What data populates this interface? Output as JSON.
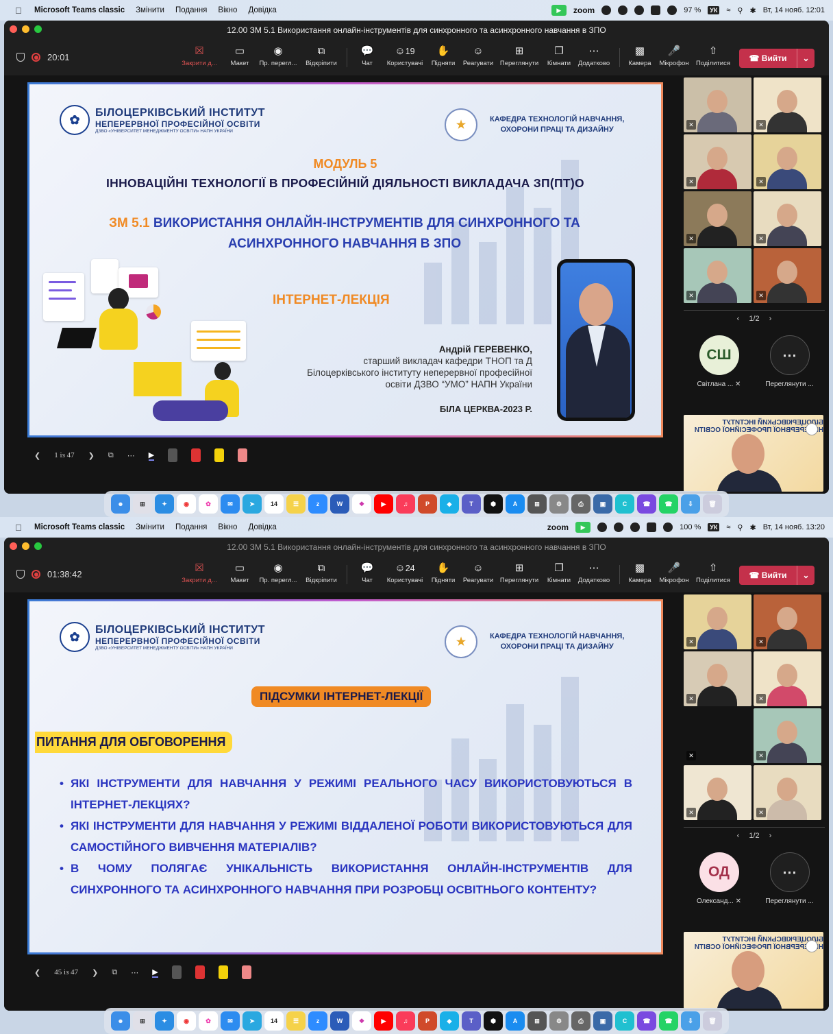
{
  "menubar": {
    "app": "Microsoft Teams classic",
    "menus": [
      "Змінити",
      "Подання",
      "Вікно",
      "Довідка"
    ],
    "zoom_label": "zoom",
    "keyboard": "УК"
  },
  "toolbar_labels": {
    "close": "Закрити д...",
    "layout": "Макет",
    "preview": "Пр. перегл...",
    "popout": "Відкріпити",
    "chat": "Чат",
    "people": "Користувачі",
    "raise": "Підняти",
    "react": "Реагувати",
    "view": "Переглянути",
    "rooms": "Кімнати",
    "more": "Додатково",
    "camera": "Камера",
    "mic": "Мікрофон",
    "share": "Поділитися",
    "leave": "Вийти"
  },
  "window_title": "12.00 ЗМ 5.1 Використання онлайн-інструментів для синхронного та асинхронного навчання в ЗПО",
  "slide_header": {
    "institute_l1": "БІЛОЦЕРКІВСЬКИЙ ІНСТИТУТ",
    "institute_l2": "НЕПЕРЕРВНОЇ ПРОФЕСІЙНОЇ ОСВІТИ",
    "institute_l3": "ДЗВО «УНІВЕРСИТЕТ МЕНЕДЖМЕНТУ ОСВІТИ» НАПН УКРАЇНИ",
    "dept_l1": "КАФЕДРА ТЕХНОЛОГІЙ НАВЧАННЯ,",
    "dept_l2": "ОХОРОНИ ПРАЦІ ТА ДИЗАЙНУ"
  },
  "shot1": {
    "battery": "97 %",
    "datetime": "Вт, 14 нояб.  12:01",
    "timer": "20:01",
    "people_count": "19",
    "slide": {
      "module": "МОДУЛЬ 5",
      "title": "ІННОВАЦІЙНІ ТЕХНОЛОГІЇ В ПРОФЕСІЙНІЙ ДІЯЛЬНОСТІ ВИКЛАДАЧА ЗП(ПТ)О",
      "sub_prefix": "ЗМ 5.1",
      "sub_text": "ВИКОРИСТАННЯ ОНЛАЙН-ІНСТРУМЕНТІВ ДЛЯ СИНХРОННОГО ТА АСИНХРОННОГО НАВЧАННЯ В ЗПО",
      "lecture": "ІНТЕРНЕТ-ЛЕКЦІЯ",
      "author_name": "Андрій ГЕРЕВЕНКО,",
      "author_l1": "старший викладач кафедри ТНОП та Д",
      "author_l2": "Білоцерківського інституту неперервної професійної",
      "author_l3": "освіти ДЗВО “УМО” НАПН України",
      "city": "БІЛА ЦЕРКВА-2023 Р."
    },
    "page": "1 із 47",
    "pager": "1/2",
    "avatar_initials": "СШ",
    "avatar_name": "Світлана ...",
    "more_label": "Переглянути ..."
  },
  "shot2": {
    "battery": "100 %",
    "datetime": "Вт, 14 нояб.  13:20",
    "timer": "01:38:42",
    "people_count": "24",
    "slide": {
      "summary": "ПІДСУМКИ ІНТЕРНЕТ-ЛЕКЦІЇ",
      "questions": "ПИТАННЯ ДЛЯ ОБГОВОРЕННЯ",
      "q1": "ЯКІ ІНСТРУМЕНТИ ДЛЯ НАВЧАННЯ У РЕЖИМІ РЕАЛЬНОГО ЧАСУ ВИКОРИСТОВУЮТЬСЯ В ІНТЕРНЕТ-ЛЕКЦІЯХ?",
      "q2": "ЯКІ ІНСТРУМЕНТИ ДЛЯ НАВЧАННЯ У РЕЖИМІ ВІДДАЛЕНОЇ РОБОТИ ВИКОРИСТОВУЮТЬСЯ ДЛЯ САМОСТІЙНОГО ВИВЧЕННЯ МАТЕРІАЛІВ?",
      "q3": "В ЧОМУ ПОЛЯГАЄ УНІКАЛЬНІСТЬ ВИКОРИСТАННЯ ОНЛАЙН-ІНСТРУМЕНТІВ ДЛЯ СИНХРОННОГО ТА АСИНХРОННОГО НАВЧАННЯ ПРИ РОЗРОБЦІ ОСВІТНЬОГО КОНТЕНТУ?"
    },
    "page": "45 із 47",
    "pager": "1/2",
    "avatar_initials": "ОД",
    "avatar_name": "Олександ...",
    "more_label": "Переглянути ..."
  },
  "selfview_title": "БІЛОЦЕРКІВСЬКИЙ ІНСТИТУТ НЕПЕРЕРВНОЇ ПРОФЕСІЙНОЇ ОСВІТИ",
  "dock_date": "14",
  "colors": {
    "accent_orange": "#f08a24",
    "slide_blue": "#2a3fb0",
    "leave_red": "#c4314b",
    "yellow": "#ffd93a"
  }
}
